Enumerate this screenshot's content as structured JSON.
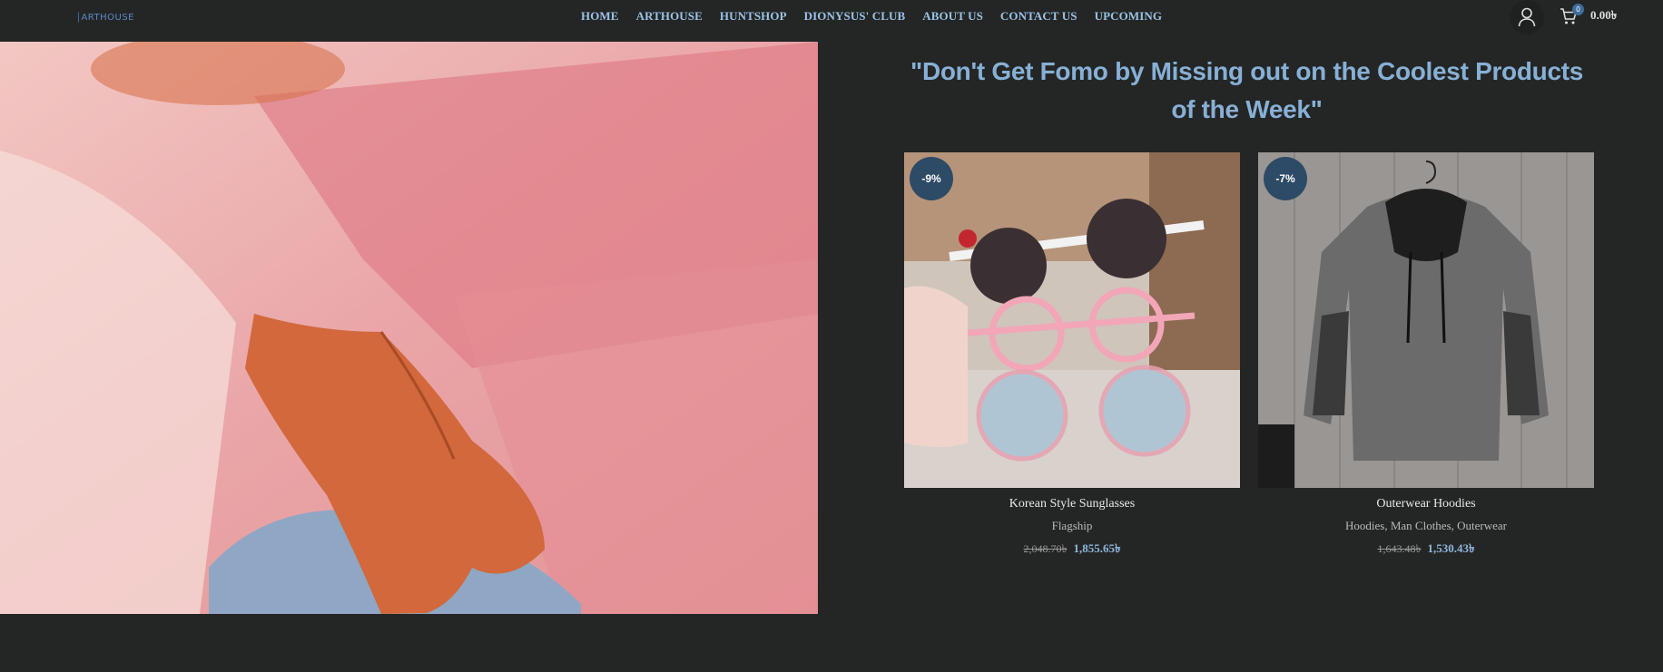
{
  "brand": {
    "logo_text": "ARTHOUSE"
  },
  "nav": {
    "items": [
      "HOME",
      "ARTHOUSE",
      "HUNTSHOP",
      "DIONYSUS' CLUB",
      "ABOUT US",
      "CONTACT US",
      "UPCOMING"
    ]
  },
  "header": {
    "cart_count": "0",
    "cart_total": "0.00৳"
  },
  "headline": "\"Don't Get Fomo by Missing out on the Coolest Products of the Week\"",
  "products": [
    {
      "discount": "-9%",
      "title": "Korean Style Sunglasses",
      "categories": "Flagship",
      "old_price": "2,048.70৳",
      "new_price": "1,855.65৳"
    },
    {
      "discount": "-7%",
      "title": "Outerwear Hoodies",
      "categories": "Hoodies, Man Clothes, Outerwear",
      "old_price": "1,643.48৳",
      "new_price": "1,530.43৳"
    }
  ],
  "colors": {
    "background": "#242625",
    "nav_link": "#9cc2e6",
    "headline": "#88b0d6",
    "badge": "#2d4a66",
    "sale_price": "#8fb6dc"
  },
  "icons": {
    "user": "user-icon",
    "cart": "cart-icon"
  }
}
